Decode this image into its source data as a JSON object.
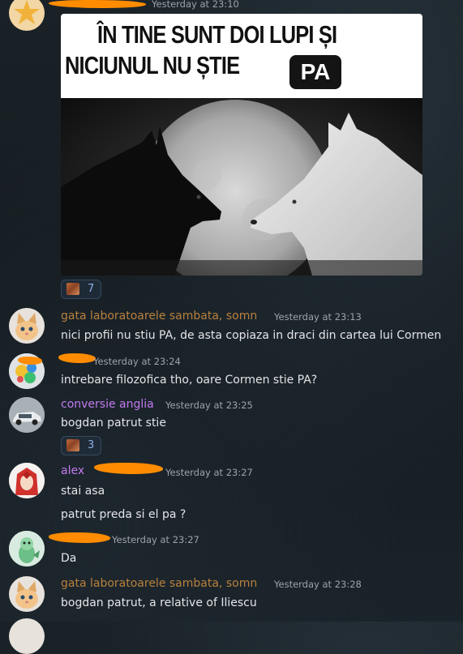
{
  "colors": {
    "orange_user": "#b9813e",
    "purple_user": "#c27bf0",
    "redaction": "#ff8c00",
    "timestamp": "#9ea3a8",
    "text": "#e3e5e8",
    "reaction_count": "#8fb0e6"
  },
  "messages": [
    {
      "timestamp": "Yesterday at 23:10",
      "meme": {
        "line1": "ÎN TINE SUNT DOI LUPI ȘI",
        "line2": "NICIUNUL NU ȘTIE",
        "badge": "PA"
      },
      "reaction": {
        "count": "7"
      }
    },
    {
      "username": "gata laboratoarele sambata, somn",
      "timestamp": "Yesterday at 23:13",
      "text": "nici profii nu stiu PA, de asta copiaza in draci din cartea lui Cormen"
    },
    {
      "timestamp": "Yesterday at 23:24",
      "text": "intrebare filozofica tho, oare Cormen stie PA?"
    },
    {
      "username": "conversie anglia",
      "timestamp": "Yesterday at 23:25",
      "text": "bogdan patrut stie",
      "reaction": {
        "count": "3"
      }
    },
    {
      "username": "alex",
      "timestamp": "Yesterday at 23:27",
      "lines": [
        "stai asa",
        "patrut preda si el pa ?"
      ]
    },
    {
      "timestamp": "Yesterday at 23:27",
      "text": "Da"
    },
    {
      "username": "gata laboratoarele sambata, somn",
      "timestamp": "Yesterday at 23:28",
      "text": "bogdan patrut, a relative of Iliescu"
    }
  ]
}
